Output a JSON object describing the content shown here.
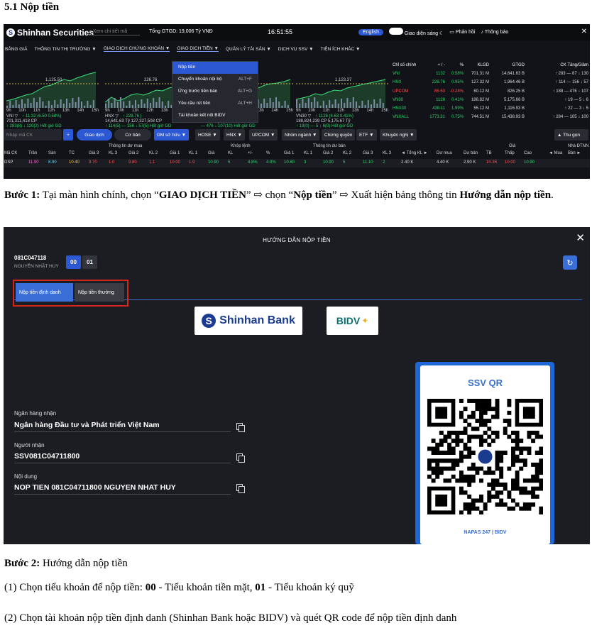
{
  "heading": "5.1 Nộp tiền",
  "board": {
    "logo": "Shinhan Securities",
    "search_placeholder": "Xem chi tiết mã",
    "total_value": "Tổng GTGD: 19,006 Tỷ VNĐ",
    "clock": "16:51:55",
    "lang": "English",
    "theme": "Giao diện sáng",
    "feedback": "Phản hồi",
    "notice": "Thông báo",
    "menu": [
      "BẢNG GIÁ",
      "THÔNG TIN THỊ TRƯỜNG ▼",
      "GIAO DỊCH CHỨNG KHOÁN ▼",
      "GIAO DỊCH TIỀN ▼",
      "QUẢN LÝ TÀI SẢN ▼",
      "DỊCH VỤ SSV ▼",
      "TIỆN ÍCH KHÁC ▼"
    ],
    "dropdown": [
      {
        "label": "Nộp tiền",
        "shortcut": ""
      },
      {
        "label": "Chuyển khoản nội bộ",
        "shortcut": "ALT+F"
      },
      {
        "label": "Ứng trước tiền bán",
        "shortcut": "ALT+G"
      },
      {
        "label": "Yêu cầu rút tiền",
        "shortcut": "ALT+H"
      },
      {
        "label": "Tài khoản kết nối BIDV",
        "shortcut": ""
      }
    ],
    "charts": [
      {
        "name": "VNI",
        "value": "1,125.50",
        "caption": "VNI ▽",
        "stats": "↑ 11.32 (6.50 0.58%)",
        "volume": "701,311,418 CP",
        "breadth": "↑ 283(8)  ↓ 120(2)  Hết giờ GD"
      },
      {
        "name": "HNX",
        "value": "226.76",
        "caption": "HNX ▽",
        "stats": "↑ 228.76 (",
        "volume": "14,641.63 Tỷ  127,327,508 CP",
        "breadth": "↑ 114(5)  — 156  ↓ 57(5)  Hết giờ GD"
      },
      {
        "name": "UPCOM",
        "value": "",
        "caption": "",
        "stats": "↓ 0.28%)",
        "volume": "826.26 Tỷ",
        "breadth": "— 476  ↓ 107(10)  Hết giờ GD"
      },
      {
        "name": "VN30",
        "value": "1,123.37",
        "caption": "VN30 ▽",
        "stats": "↑ 1128 (4.63 0.41%)",
        "volume": "188,824,239 CP  5,175.67 Tỷ",
        "breadth": "↑ 19(0)  — 5  ↓ 6(0)  Hết giờ GD"
      }
    ],
    "time_ticks": [
      "9h",
      "10h",
      "11h",
      "12h",
      "13h",
      "14h",
      "15h"
    ],
    "index_headers": [
      "Chỉ số chính",
      "+ / -",
      "%",
      "KLGD",
      "GTGD",
      "CK Tăng/Giảm"
    ],
    "indices": [
      {
        "name": "VNI",
        "price": "1132",
        "pct": "0.58%",
        "vol": "701.31 M",
        "val": "14,641.63 B",
        "breadth": "↑ 283 — 87 ↓ 130",
        "cls": "up"
      },
      {
        "name": "HNX",
        "price": "228.76",
        "pct": "0.95%",
        "vol": "127.32 M",
        "val": "1,964.46 B",
        "breadth": "↑ 114 — 156 ↓ 57",
        "cls": "up"
      },
      {
        "name": "UPCOM",
        "price": "85.53",
        "pct": "-0.28%",
        "vol": "60.12 M",
        "val": "826.25 B",
        "breadth": "↑ 188 — 476 ↓ 107",
        "cls": "dn"
      },
      {
        "name": "VN30",
        "price": "1128",
        "pct": "0.41%",
        "vol": "188.82 M",
        "val": "5,175.66 B",
        "breadth": "↑ 19 — 5 ↓ 6",
        "cls": "up"
      },
      {
        "name": "HNX30",
        "price": "438.11",
        "pct": "1.99%",
        "vol": "55.12 M",
        "val": "1,116.93 B",
        "breadth": "↑ 22 — 3 ↓ 5",
        "cls": "up"
      },
      {
        "name": "VNXALL",
        "price": "1773.31",
        "pct": "0.75%",
        "vol": "744.51 M",
        "val": "15,438.93 B",
        "breadth": "↑ 284 — 105 ↓ 100",
        "cls": "up"
      }
    ],
    "filter": {
      "input_placeholder": "Nhập mã CK",
      "plus": "+",
      "buy_tab": "Giao dịch",
      "base_tab": "Cơ bản",
      "chips": [
        "DM sở hữu ▼",
        "HOSE ▼",
        "HNX ▼",
        "UPCOM ▼",
        "Nhóm ngành ▼",
        "Chứng quyền",
        "ETF ▼",
        "Khuyến nghị ▼"
      ],
      "collapse": "▲ Thu gọn"
    },
    "table_groups": [
      "Thông tin dư mua",
      "Khớp lệnh",
      "Thông tin dư bán",
      "Giá",
      "Nhà ĐTNN"
    ],
    "table_headers": [
      "Mã CK",
      "Trần",
      "Sàn",
      "TC",
      "Giá 3",
      "KL 3",
      "Giá 2",
      "KL 2",
      "Giá 1",
      "KL 1",
      "Giá",
      "KL",
      "+/-",
      "%",
      "Giá 1",
      "KL 1",
      "Giá 2",
      "KL 2",
      "Giá 3",
      "KL 3",
      "◄ Tổng KL ►",
      "Dư mua",
      "Dư bán",
      "TB",
      "Thấp",
      "Cao",
      "◄ Mua",
      "Bán ►"
    ],
    "row": [
      "DSP",
      "11.90",
      "8.90",
      "10.40",
      "9.70",
      "1.0",
      "9.80",
      "1.1",
      "10.00",
      "1.9",
      "10.90",
      "5",
      "4.8%",
      "4.9%",
      "10.80",
      "3",
      "10.90",
      "5",
      "11.10",
      "2",
      "2.40 K",
      "4.40 K",
      "2.90 K",
      "10.35",
      "10.00",
      "10.90",
      "",
      ""
    ]
  },
  "step1": {
    "label": "Bước 1:",
    "t1": " Tại màn hình chính, chọn “",
    "b1": "GIAO DỊCH TIỀN",
    "t2": "” ⇨ chọn “",
    "b2": "Nộp tiền",
    "t3": "” ⇨ Xuất hiện bảng thông tin ",
    "b3": "Hướng dẫn nộp tiền",
    "t4": "."
  },
  "dialog": {
    "title": "HƯỚNG DẪN NỘP TIỀN",
    "account_no": "081C047118",
    "account_name": "NGUYỄN NHẬT HUY",
    "sub_accounts": [
      "00",
      "01"
    ],
    "tabs": [
      "Nộp tiền định danh",
      "Nộp tiền thường"
    ],
    "banks": [
      "Shinhan Bank",
      "BIDV"
    ],
    "fields": [
      {
        "label": "Ngân hàng nhận",
        "value": "Ngân hàng Đầu tư và Phát triển Việt Nam"
      },
      {
        "label": "Người nhận",
        "value": "SSV081C04711800"
      },
      {
        "label": "Nội dung",
        "value": "NOP TIEN 081C04711800 NGUYEN NHAT HUY"
      }
    ],
    "qr_title": "SSV QR",
    "qr_footer": "NAPAS 247  |  BIDV"
  },
  "step2": {
    "label": "Bước 2:",
    "text": " Hướng dẫn nộp tiền",
    "line1_a": "(1) Chọn tiểu khoản để nộp tiền: ",
    "line1_b": "00",
    "line1_c": " - Tiểu khoản tiền mặt, ",
    "line1_d": "01",
    "line1_e": " - Tiểu khoản ký quỹ",
    "line2": "(2) Chọn tài khoản nộp tiền định danh (Shinhan Bank hoặc BIDV) và quét QR code để nộp tiền định danh"
  }
}
